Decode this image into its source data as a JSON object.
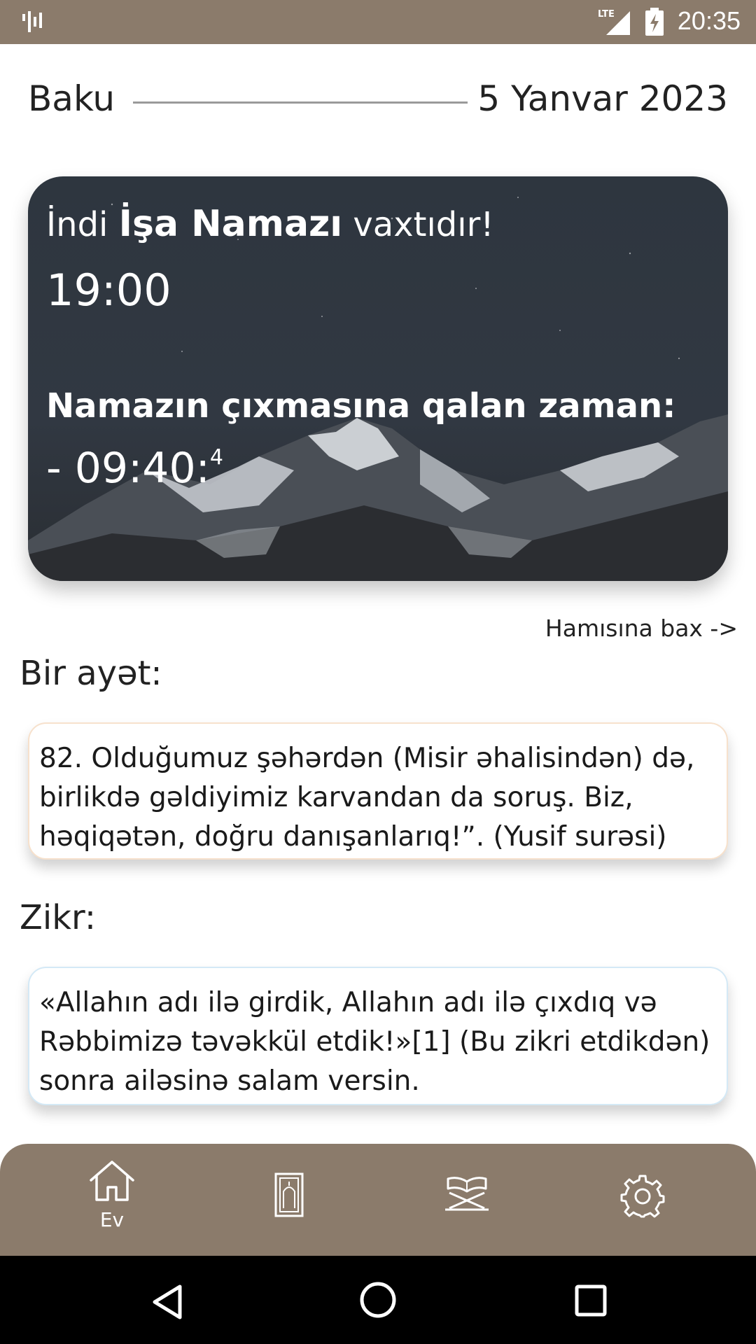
{
  "status_bar": {
    "time": "20:35",
    "network_label": "LTE",
    "icons": [
      "signal-activity-icon",
      "lte-signal-icon",
      "battery-charging-icon"
    ]
  },
  "header": {
    "city": "Baku",
    "date": "5 Yanvar 2023"
  },
  "prayer_card": {
    "now_prefix": "İndi",
    "prayer_name": "İşa Namazı",
    "now_suffix": "vaxtıdır!",
    "prayer_time": "19:00",
    "remaining_label": "Namazın çıxmasına qalan zaman:",
    "countdown": "- 09:40:",
    "countdown_seconds": "4"
  },
  "see_all_link": "Hamısına bax ->",
  "ayah": {
    "title": "Bir ayət:",
    "text": "82. Olduğumuz şəhərdən (Misir əhalisindən) də, birlikdə gəldiyimiz karvandan da soruş. Biz, həqiqətən, doğru danışanlarıq!”. (Yusif surəsi)",
    "border_color": "#f7e1cc"
  },
  "zikr": {
    "title": "Zikr:",
    "text": "«Allahın adı ilə girdik, Allahın adı ilə çıxdıq və Rəbbimizə təvəkkül etdik!»[1] (Bu zikri etdikdən) sonra ailəsinə salam versin.",
    "border_color": "#d4e9f6"
  },
  "bottom_nav": {
    "items": [
      {
        "icon": "home-icon",
        "label": "Ev"
      },
      {
        "icon": "prayer-rug-icon",
        "label": ""
      },
      {
        "icon": "quran-stand-icon",
        "label": ""
      },
      {
        "icon": "gear-icon",
        "label": ""
      }
    ]
  },
  "system_nav": {
    "icons": [
      "back-icon",
      "home-circle-icon",
      "recents-icon"
    ]
  },
  "colors": {
    "brand_brown": "#8b7b6b",
    "card_dark": "#2b3036",
    "text": "#1a1a1a"
  }
}
